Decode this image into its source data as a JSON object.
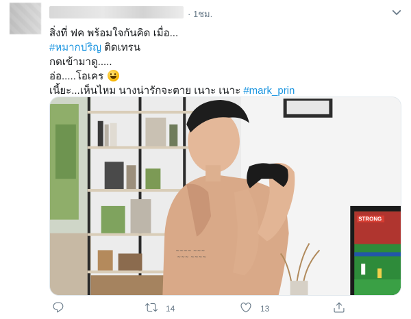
{
  "tweet": {
    "time": "· 1ชม.",
    "lines": {
      "l1": "สิ่งที่ ฟค พร้อมใจกันคิด เมื่อ...",
      "l2_tag": "#หมากปริญ",
      "l2_rest": " ติดเทรน",
      "l3": "กดเข้ามาดู.....",
      "l4": "อ่อ.....โอเคร",
      "l5_text": "เนี้ยะ...เห็นไหม นางน่ารักจะตาย เนาะ เนาะ ",
      "l5_tag": "#mark_prin"
    },
    "stats": {
      "retweets": "14",
      "likes": "13"
    }
  },
  "icons": {
    "caret": "chevron-down-icon",
    "reply": "reply-icon",
    "retweet": "retweet-icon",
    "like": "heart-icon",
    "share": "share-icon"
  },
  "colors": {
    "link": "#1b95e0",
    "muted": "#657786"
  }
}
